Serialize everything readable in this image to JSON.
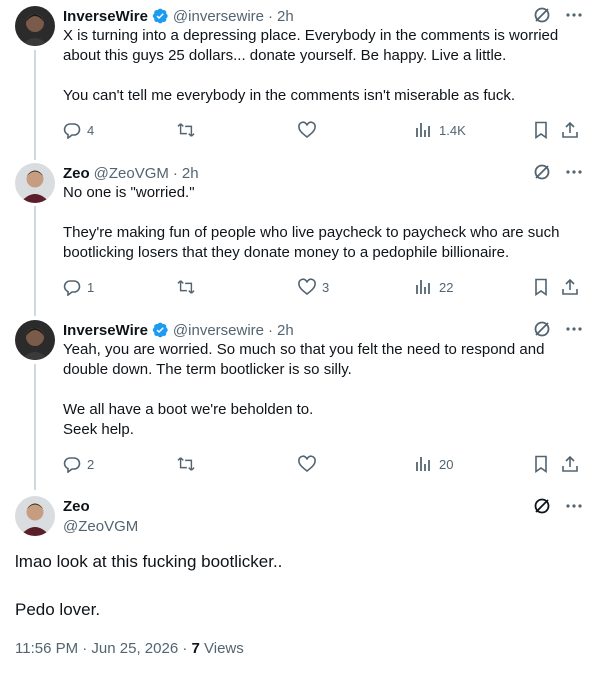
{
  "tweets": [
    {
      "name": "InverseWire",
      "verified": true,
      "handle": "@inversewire",
      "sep": "·",
      "time": "2h",
      "text": "X is turning into a depressing place. Everybody in the comments is worried about this guys 25 dollars... donate yourself. Be happy. Live a little.\n\nYou can't tell me everybody in the comments isn't miserable as fuck.",
      "replies": "4",
      "reposts": "",
      "likes": "",
      "views": "1.4K"
    },
    {
      "name": "Zeo",
      "verified": false,
      "handle": "@ZeoVGM",
      "sep": "·",
      "time": "2h",
      "text": "No one is \"worried.\"\n\nThey're making fun of people who live paycheck to paycheck who are such bootlicking losers that they donate money to a pedophile billionaire.",
      "replies": "1",
      "reposts": "",
      "likes": "3",
      "views": "22"
    },
    {
      "name": "InverseWire",
      "verified": true,
      "handle": "@inversewire",
      "sep": "·",
      "time": "2h",
      "text": "Yeah, you are worried. So much so that you felt the need to respond and double down. The term bootlicker is so silly.\n\nWe all have a boot we're beholden to.\nSeek help.",
      "replies": "2",
      "reposts": "",
      "likes": "",
      "views": "20"
    }
  ],
  "main": {
    "name": "Zeo",
    "handle": "@ZeoVGM",
    "text": "lmao look at this fucking bootlicker..\n\nPedo lover.",
    "timestamp": "11:56 PM · Jun 25, 2026 · ",
    "views_count": "7",
    "views_label": " Views"
  },
  "colors": {
    "text": "#0f1419",
    "muted": "#536471",
    "verified": "#1d9bf0",
    "thread_line": "#cfd9de"
  },
  "icons": [
    "grok-icon",
    "more-icon",
    "reply-icon",
    "repost-icon",
    "like-icon",
    "views-icon",
    "bookmark-icon",
    "share-icon",
    "verified-badge-icon"
  ]
}
